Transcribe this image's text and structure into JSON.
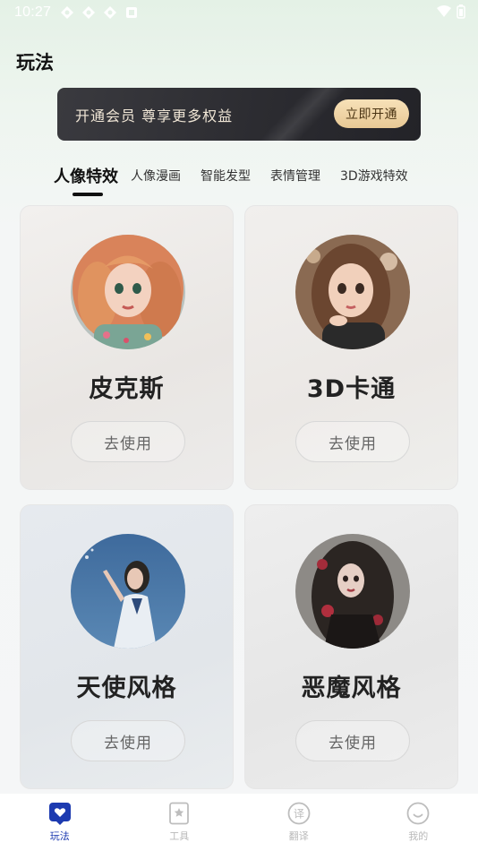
{
  "status_bar": {
    "time": "10:27",
    "left_icons": [
      "app-icon",
      "app-icon",
      "app-icon",
      "app-icon"
    ],
    "right_icons": [
      "wifi-icon",
      "battery-icon"
    ]
  },
  "page": {
    "title": "玩法"
  },
  "vip_banner": {
    "text": "开通会员 尊享更多权益",
    "button_label": "立即开通"
  },
  "tabs": [
    {
      "label": "人像特效",
      "active": true
    },
    {
      "label": "人像漫画",
      "active": false
    },
    {
      "label": "智能发型",
      "active": false
    },
    {
      "label": "表情管理",
      "active": false
    },
    {
      "label": "3D游戏特效",
      "active": false
    }
  ],
  "cards": [
    {
      "title": "皮克斯",
      "button_label": "去使用",
      "avatar": "pixar-style-girl-portrait"
    },
    {
      "title": "3D卡通",
      "button_label": "去使用",
      "avatar": "3d-cartoon-girl-portrait"
    },
    {
      "title": "天使风格",
      "button_label": "去使用",
      "avatar": "angel-style-girl-photo"
    },
    {
      "title": "恶魔风格",
      "button_label": "去使用",
      "avatar": "devil-style-girl-photo"
    }
  ],
  "bottom_nav": [
    {
      "label": "玩法",
      "icon": "heart-chat-icon",
      "active": true
    },
    {
      "label": "工具",
      "icon": "bookmark-star-icon",
      "active": false
    },
    {
      "label": "翻译",
      "icon": "translate-icon",
      "active": false
    },
    {
      "label": "我的",
      "icon": "smile-face-icon",
      "active": false
    }
  ],
  "colors": {
    "accent": "#1c3ab0",
    "vip_button": "#f0d6a7",
    "banner_bg": "#2e2e33"
  }
}
